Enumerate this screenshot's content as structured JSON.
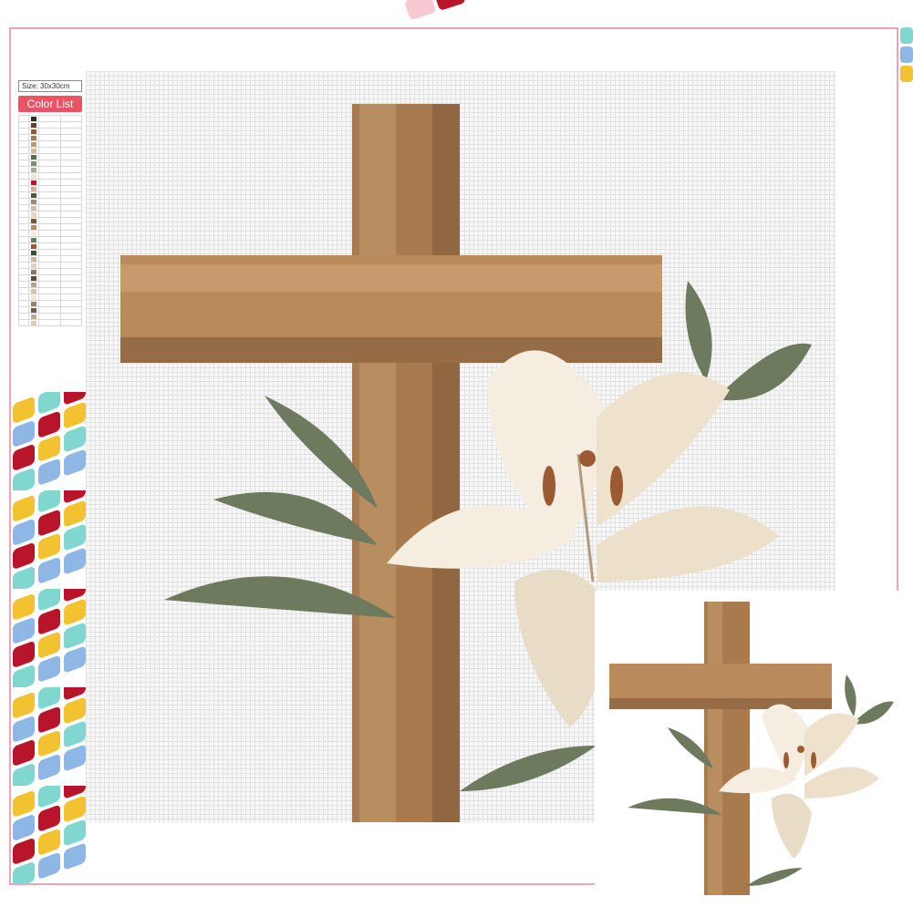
{
  "size_label": "Size: 30x30cm",
  "color_list_label": "Color List",
  "colors": {
    "frame_border": "#f0a3b4",
    "wood_light": "#b88a5c",
    "wood_dark": "#7a5434",
    "lily_petal": "#f4ede0",
    "lily_shade": "#d9c3a5",
    "leaf": "#6d7a5e",
    "stamen": "#9b5a32",
    "bead_red": "#b8142a",
    "bead_yellow": "#f2c230",
    "bead_cyan": "#7fd7d0",
    "bead_blue": "#8fb7e6"
  },
  "icons": [
    "wooden-cross-icon",
    "lily-flower-icon",
    "diamond-bead-icon"
  ]
}
